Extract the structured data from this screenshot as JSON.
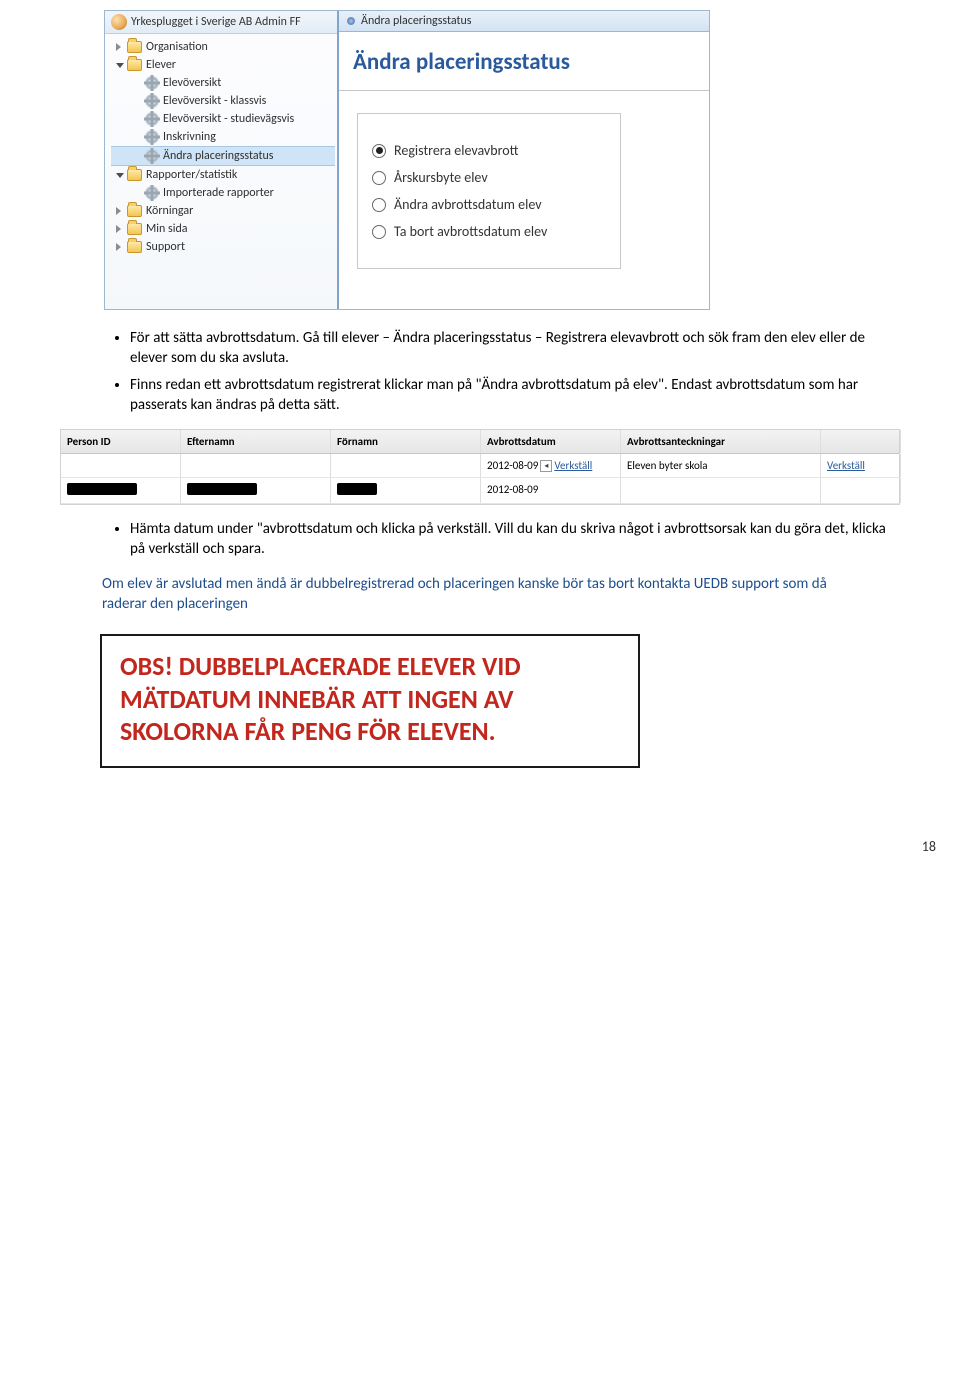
{
  "ui": {
    "tree": {
      "header_title": "Yrkesplugget i Sverige AB Admin FF",
      "items": [
        {
          "label": "Organisation",
          "icon": "folder",
          "arrow": "closed",
          "indent": 0
        },
        {
          "label": "Elever",
          "icon": "folder",
          "arrow": "open",
          "indent": 0
        },
        {
          "label": "Elevöversikt",
          "icon": "gear",
          "arrow": "none",
          "indent": 1
        },
        {
          "label": "Elevöversikt - klassvis",
          "icon": "gear",
          "arrow": "none",
          "indent": 1
        },
        {
          "label": "Elevöversikt - studievägsvis",
          "icon": "gear",
          "arrow": "none",
          "indent": 1
        },
        {
          "label": "Inskrivning",
          "icon": "gear",
          "arrow": "none",
          "indent": 1
        },
        {
          "label": "Ändra placeringsstatus",
          "icon": "gear",
          "arrow": "none",
          "indent": 1,
          "selected": true
        },
        {
          "label": "Rapporter/statistik",
          "icon": "folder",
          "arrow": "open",
          "indent": 0
        },
        {
          "label": "Importerade rapporter",
          "icon": "gear",
          "arrow": "none",
          "indent": 1
        },
        {
          "label": "Körningar",
          "icon": "folder",
          "arrow": "closed",
          "indent": 0
        },
        {
          "label": "Min sida",
          "icon": "folder",
          "arrow": "closed",
          "indent": 0
        },
        {
          "label": "Support",
          "icon": "folder",
          "arrow": "closed",
          "indent": 0
        }
      ]
    },
    "panel": {
      "breadcrumb": "Ändra placeringsstatus",
      "title": "Ändra placeringsstatus",
      "options": [
        {
          "label": "Registrera elevavbrott",
          "checked": true
        },
        {
          "label": "Årskursbyte elev",
          "checked": false
        },
        {
          "label": "Ändra avbrottsdatum elev",
          "checked": false
        },
        {
          "label": "Ta bort avbrottsdatum elev",
          "checked": false
        }
      ]
    }
  },
  "bullets_top": [
    "För att sätta avbrottsdatum. Gå till elever – Ändra placeringsstatus – Registrera elevavbrott och sök fram den elev eller de elever som du ska avsluta.",
    "Finns redan ett avbrottsdatum registrerat klickar man på \"Ändra avbrottsdatum på elev\". Endast avbrottsdatum som har passerats kan ändras på detta sätt."
  ],
  "table": {
    "headers": [
      "Person ID",
      "Efternamn",
      "Förnamn",
      "Avbrottsdatum",
      "Avbrottsanteckningar",
      ""
    ],
    "row1": {
      "date": "2012-08-09",
      "note": "Eleven byter skola",
      "verkstall_left": "Verkställ",
      "action": "Verkställ"
    },
    "row2": {
      "date": "2012-08-09"
    }
  },
  "bullets_bottom": [
    "Hämta datum under \"avbrottsdatum och klicka på verkställ. Vill du kan du skriva något i avbrottsorsak kan du göra det, klicka på verkställ och spara."
  ],
  "note": "Om elev är avslutad men ändå är dubbelregistrerad och placeringen kanske bör tas bort kontakta UEDB support som då raderar den placeringen",
  "obs_line1": "OBS! DUBBELPLACERADE ELEVER VID",
  "obs_line2": "MÄTDATUM INNEBÄR ATT INGEN AV",
  "obs_line3": "SKOLORNA FÅR PENG FÖR ELEVEN.",
  "page_number": "18"
}
